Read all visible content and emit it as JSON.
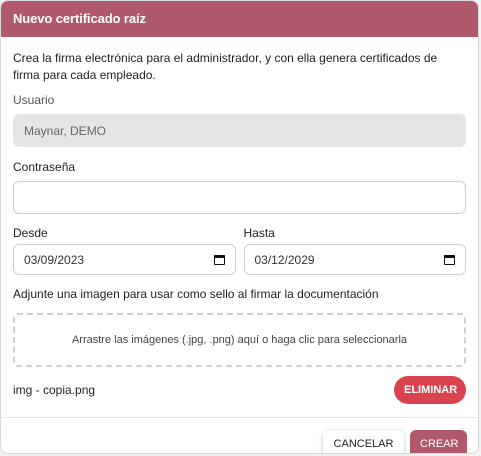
{
  "dialog": {
    "title": "Nuevo certificado raíz",
    "description": "Crea la firma electrónica para el administrador, y con ella genera certificados de firma para cada empleado."
  },
  "form": {
    "usuario_label": "Usuario",
    "usuario_value": "Maynar, DEMO",
    "password_label": "Contraseña",
    "password_value": "",
    "desde_label": "Desde",
    "desde_value": "03/09/2023",
    "hasta_label": "Hasta",
    "hasta_value": "03/12/2029",
    "stamp_label": "Adjunte una imagen para usar como sello al firmar la documentación",
    "dropzone_text": "Arrastre las imágenes (.jpg, .png) aquí o haga clic para seleccionarla",
    "file_name": "img - copia.png",
    "delete_label": "ELIMINAR"
  },
  "footer": {
    "cancel_label": "CANCELAR",
    "create_label": "CREAR"
  },
  "colors": {
    "accent": "#b0596a",
    "danger": "#d9434f"
  },
  "icons": {
    "calendar": "calendar-icon"
  }
}
